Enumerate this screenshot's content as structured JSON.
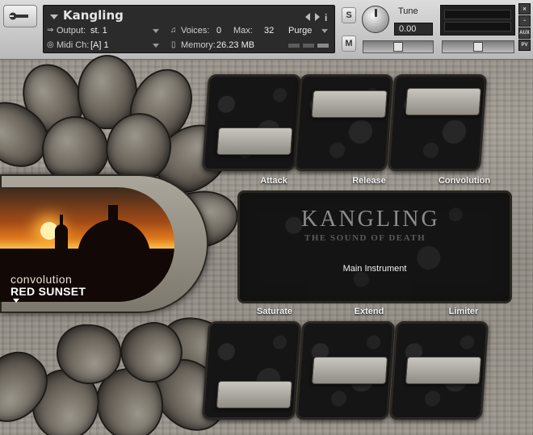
{
  "header": {
    "instrument_name": "Kangling",
    "output_label": "Output:",
    "output_value": "st. 1",
    "voices_label": "Voices:",
    "voices_value": "0",
    "max_label": "Max:",
    "max_value": "32",
    "purge_label": "Purge",
    "midi_label": "Midi Ch:",
    "midi_value": "[A]  1",
    "memory_label": "Memory:",
    "memory_value": "26.23 MB",
    "solo_label": "S",
    "mute_label": "M",
    "tune_label": "Tune",
    "tune_value": "0.00",
    "aux_label": "AUX",
    "pv_label": "PV"
  },
  "preset": {
    "category": "convolution",
    "name": "RED SUNSET"
  },
  "slots": {
    "attack": "Attack",
    "release": "Release",
    "convolution": "Convolution",
    "saturate": "Saturate",
    "extend": "Extend",
    "limiter": "Limiter"
  },
  "slot_levels": {
    "attack": 0.18,
    "release": 0.82,
    "convolution": 0.86,
    "saturate": 0.1,
    "extend": 0.5,
    "limiter": 0.5
  },
  "center": {
    "logo": "KANGLING",
    "tagline": "THE SOUND OF DEATH",
    "main_label": "Main Instrument"
  }
}
